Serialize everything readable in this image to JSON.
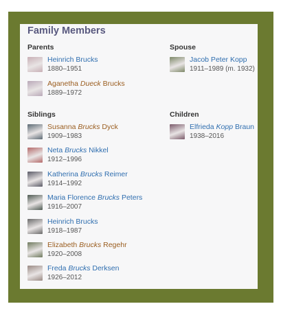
{
  "title": "Family Members",
  "sections": {
    "parents": {
      "heading": "Parents",
      "people": [
        {
          "first": "Heinrich Brucks",
          "maiden": "",
          "last": "",
          "dates": "1880–1951",
          "color": "blue",
          "thumb": "#c9b0b6"
        },
        {
          "first": "Aganetha ",
          "maiden": "Dueck",
          "last": " Brucks",
          "dates": "1889–1972",
          "color": "brown",
          "thumb": "#b9a8b8"
        }
      ]
    },
    "spouse": {
      "heading": "Spouse",
      "people": [
        {
          "first": "Jacob Peter Kopp",
          "maiden": "",
          "last": "",
          "dates": "1911–1989 (m. 1932)",
          "color": "blue",
          "thumb": "#7d8868"
        }
      ]
    },
    "siblings": {
      "heading": "Siblings",
      "people": [
        {
          "first": "Susanna ",
          "maiden": "Brucks",
          "last": " Dyck",
          "dates": "1909–1983",
          "color": "brown",
          "thumb": "#5c6a74"
        },
        {
          "first": "Neta ",
          "maiden": "Brucks",
          "last": " Nikkel",
          "dates": "1912–1996",
          "color": "blue",
          "thumb": "#b56a6a"
        },
        {
          "first": "Katherina ",
          "maiden": "Brucks",
          "last": " Reimer",
          "dates": "1914–1992",
          "color": "blue",
          "thumb": "#5a5a66"
        },
        {
          "first": "Maria Florence ",
          "maiden": "Brucks",
          "last": " Peters",
          "dates": "1916–2007",
          "color": "blue",
          "thumb": "#4e5a52"
        },
        {
          "first": "Heinrich Brucks",
          "maiden": "",
          "last": "",
          "dates": "1918–1987",
          "color": "blue",
          "thumb": "#6a6a6a"
        },
        {
          "first": "Elizabeth ",
          "maiden": "Brucks",
          "last": " Regehr",
          "dates": "1920–2008",
          "color": "brown",
          "thumb": "#6f7a5e"
        },
        {
          "first": "Freda ",
          "maiden": "Brucks",
          "last": " Derksen",
          "dates": "1926–2012",
          "color": "blue",
          "thumb": "#9a8a84"
        }
      ]
    },
    "children": {
      "heading": "Children",
      "people": [
        {
          "first": "Elfrieda ",
          "maiden": "Kopp",
          "last": " Braun",
          "dates": "1938–2016",
          "color": "blue",
          "thumb": "#7a5a6a"
        }
      ]
    }
  }
}
